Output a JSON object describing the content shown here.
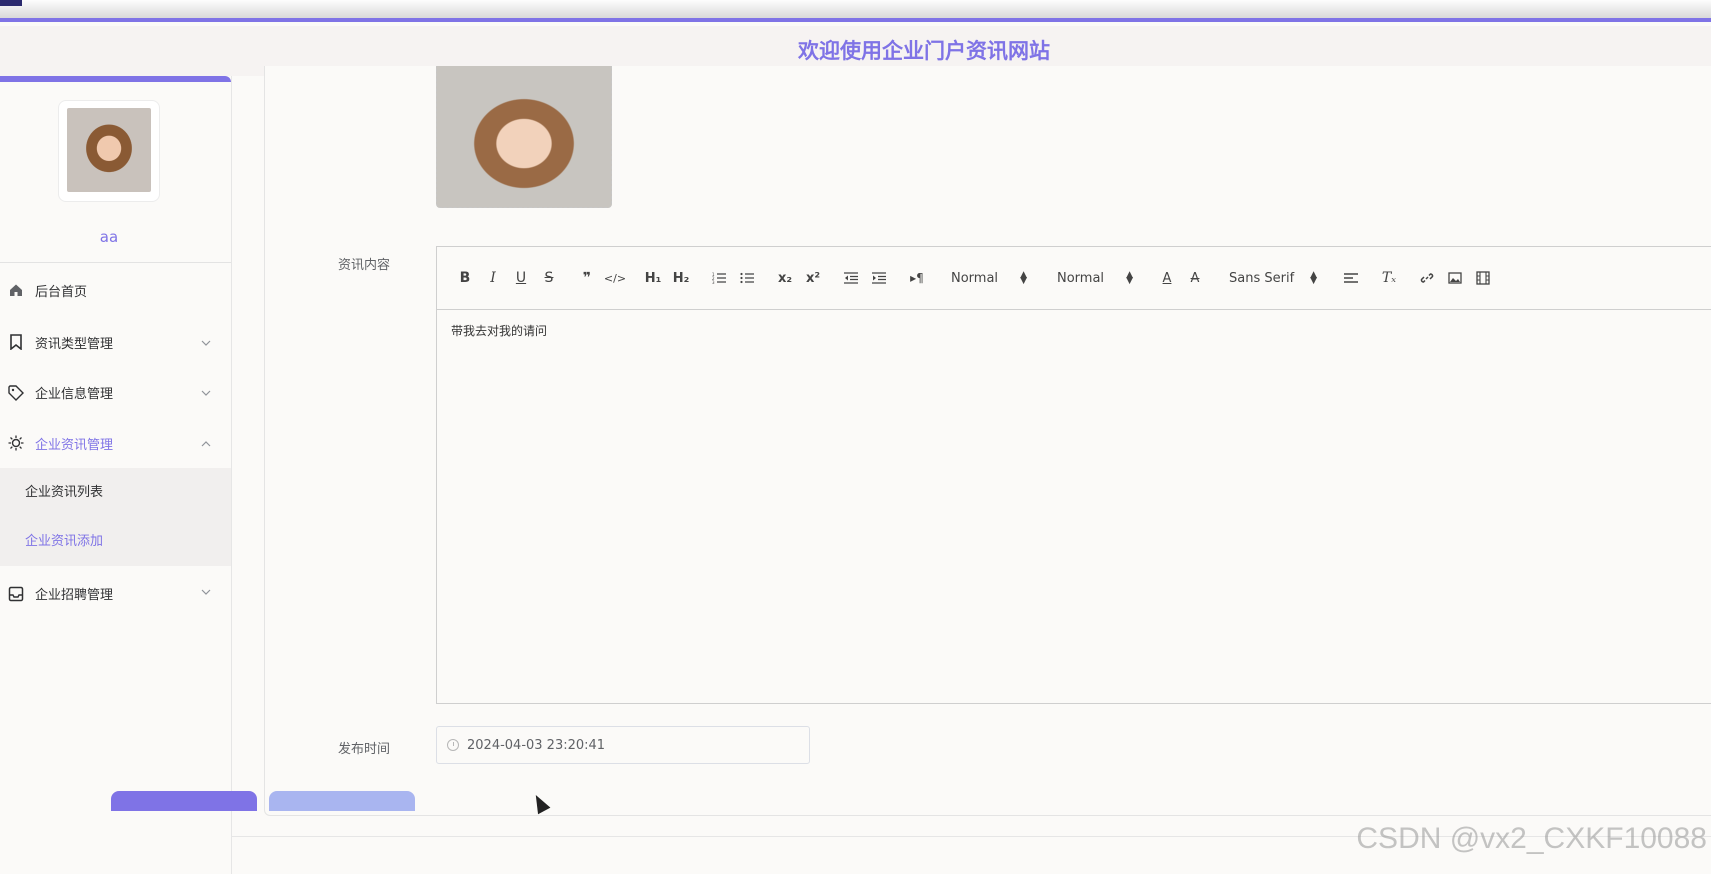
{
  "header": {
    "title": "欢迎使用企业门户资讯网站"
  },
  "user": {
    "name": "aa"
  },
  "sidebar": {
    "items": [
      {
        "label": "后台首页",
        "icon": "home-icon"
      },
      {
        "label": "资讯类型管理",
        "icon": "bookmark-icon"
      },
      {
        "label": "企业信息管理",
        "icon": "tag-icon"
      },
      {
        "label": "企业资讯管理",
        "icon": "sun-icon",
        "expanded": true
      },
      {
        "label": "企业招聘管理",
        "icon": "inbox-icon"
      }
    ],
    "sub_items": [
      {
        "label": "企业资讯列表"
      },
      {
        "label": "企业资讯添加",
        "active": true
      }
    ]
  },
  "form": {
    "content_label": "资讯内容",
    "content_text": "带我去对我的请问",
    "publish_label": "发布时间",
    "publish_value": "2024-04-03 23:20:41"
  },
  "editor_toolbar": {
    "header_select": "Normal",
    "size_select": "Normal",
    "font_select": "Sans Serif"
  },
  "watermark": "CSDN @vx2_CXKF10088",
  "colors": {
    "accent": "#7f73e6",
    "secondary_button": "#a9b5f0"
  }
}
